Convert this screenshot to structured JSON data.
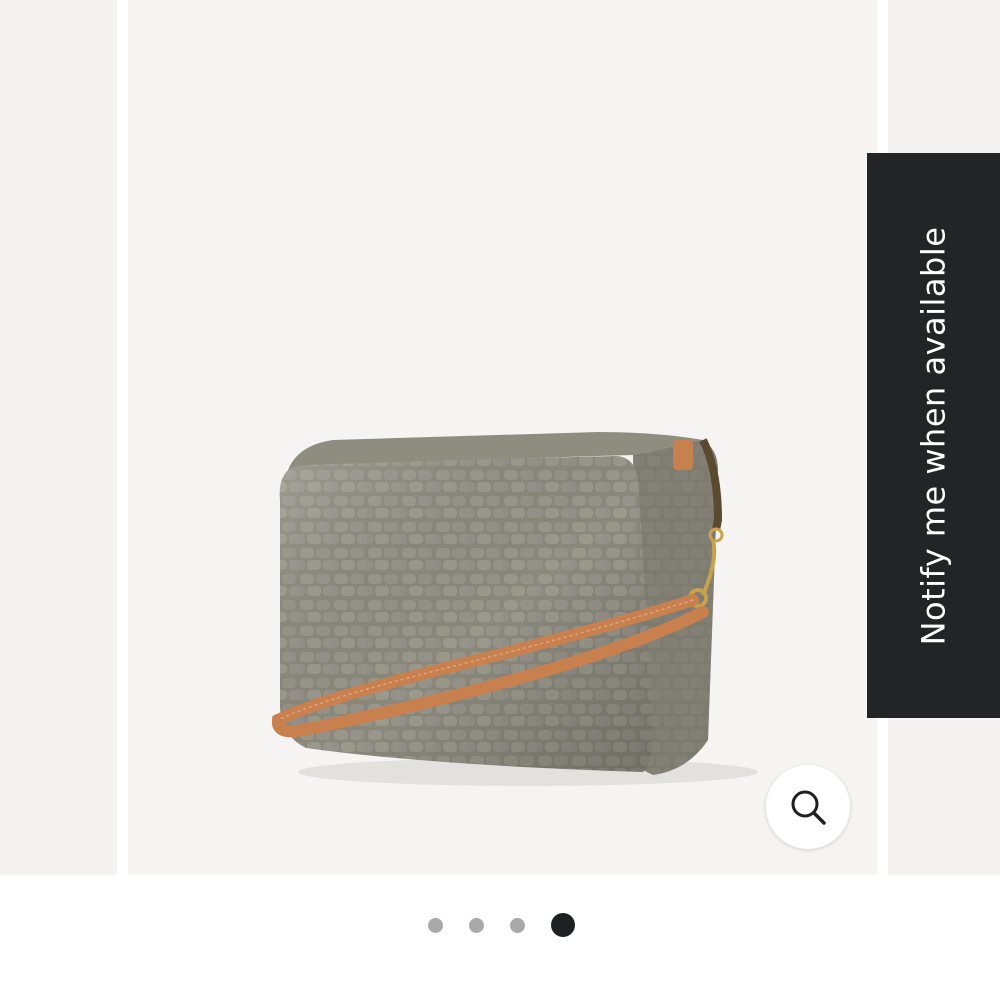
{
  "notify": {
    "label": "Notify me when available"
  },
  "zoom": {
    "icon": "search-icon"
  },
  "carousel": {
    "slide_count": 4,
    "active_index": 4,
    "dot_colors": {
      "inactive": "#a9a9a9",
      "active": "#1f2021"
    }
  },
  "product": {
    "image": "gray croc-embossed leather crossbody bag with tan strap and gold zipper",
    "colors": {
      "bag": "#8a877b",
      "strap": "#c8804e",
      "hardware": "#c9a14a"
    }
  }
}
